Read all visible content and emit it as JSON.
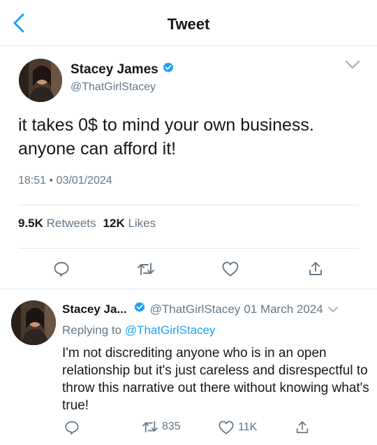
{
  "header": {
    "title": "Tweet"
  },
  "main_tweet": {
    "name": "Stacey James",
    "handle": "@ThatGirlStacey",
    "text_line1": "it takes 0$ to mind your own business.",
    "text_line2": "anyone can afford it!",
    "time": "18:51",
    "separator": "•",
    "date": "03/01/2024",
    "retweets_count": "9.5K",
    "retweets_label": "Retweets",
    "likes_count": "12K",
    "likes_label": "Likes"
  },
  "reply_tweet": {
    "name": "Stacey Ja...",
    "handle": "@ThatGirlStacey",
    "date": "01 March 2024",
    "replying_prefix": "Replying to",
    "replying_handle": "@ThatGirlStacey",
    "text": "I'm not discrediting anyone who is in an open relationship but it's just careless and disrespectful to throw this narrative out there without knowing what's true!",
    "retweets": "835",
    "likes": "11K"
  },
  "icons": {
    "back": "chevron-left-icon",
    "verified": "verified-badge-icon",
    "more": "chevron-down-icon",
    "reply": "speech-bubble-icon",
    "retweet": "retweet-icon",
    "like": "heart-icon",
    "share": "share-icon"
  },
  "colors": {
    "accent": "#1da1f2",
    "text": "#14171a",
    "secondary": "#657786",
    "border": "#e1e8ed",
    "verified": "#1da1f2"
  }
}
